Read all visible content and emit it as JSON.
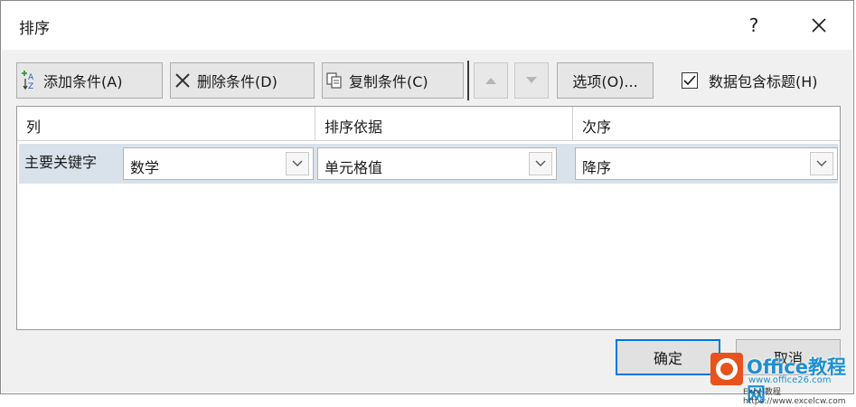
{
  "window": {
    "title": "排序",
    "help_label": "?"
  },
  "toolbar": {
    "add_label": "添加条件(A)",
    "delete_label": "删除条件(D)",
    "copy_label": "复制条件(C)",
    "options_label": "选项(O)...",
    "has_headers_label": "数据包含标题(H)",
    "has_headers_checked": true
  },
  "grid": {
    "headers": [
      "列",
      "排序依据",
      "次序"
    ],
    "rows": [
      {
        "label": "主要关键字",
        "column": "数学",
        "sort_on": "单元格值",
        "order": "降序"
      }
    ]
  },
  "buttons": {
    "ok": "确定",
    "cancel": "取消"
  },
  "watermark": {
    "brand": "Office教程网",
    "url1": "www.office26.com",
    "url2": "Excel教程 https://www.excelcw.com"
  },
  "colors": {
    "accent": "#0078d7",
    "row_highlight": "#d9e1ea",
    "watermark_orange": "#e8521c",
    "watermark_blue": "#1f8fd1"
  }
}
